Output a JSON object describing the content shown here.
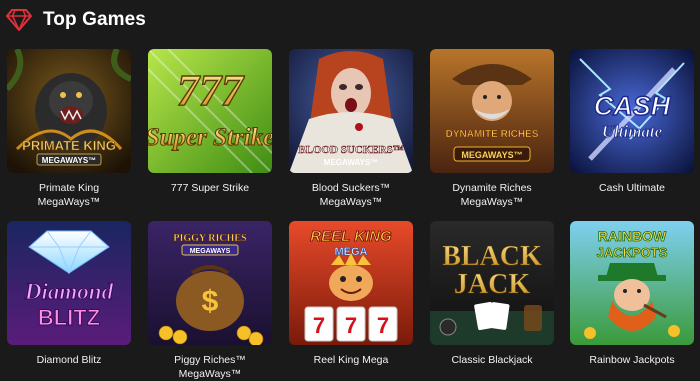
{
  "header": {
    "title": "Top Games"
  },
  "colors": {
    "background": "#1a1a1a",
    "brand": "#e0303a"
  },
  "games": [
    {
      "name": "Primate King MegaWays™",
      "art_title": "PRIMATE KING",
      "art_sub": "MEGAWAYS™"
    },
    {
      "name": "777 Super Strike",
      "art_title": "777",
      "art_sub": "Super Strike"
    },
    {
      "name": "Blood Suckers™ MegaWays™",
      "art_title": "BLOOD SUCKERS™",
      "art_sub": "MEGAWAYS™"
    },
    {
      "name": "Dynamite Riches MegaWays™",
      "art_title": "DYNAMITE RICHES",
      "art_sub": "MEGAWAYS™"
    },
    {
      "name": "Cash Ultimate",
      "art_title": "CASH",
      "art_sub": "Ultimate"
    },
    {
      "name": "Diamond Blitz",
      "art_title": "Diamond",
      "art_sub": "BLITZ"
    },
    {
      "name": "Piggy Riches™ MegaWays™",
      "art_title": "PIGGY RICHES",
      "art_sub": "MEGAWAYS"
    },
    {
      "name": "Reel King Mega",
      "art_title": "REEL KING",
      "art_sub": "MEGA"
    },
    {
      "name": "Classic Blackjack",
      "art_title": "BLACK",
      "art_sub": "JACK"
    },
    {
      "name": "Rainbow Jackpots",
      "art_title": "RAINBOW",
      "art_sub": "JACKPOTS"
    }
  ]
}
